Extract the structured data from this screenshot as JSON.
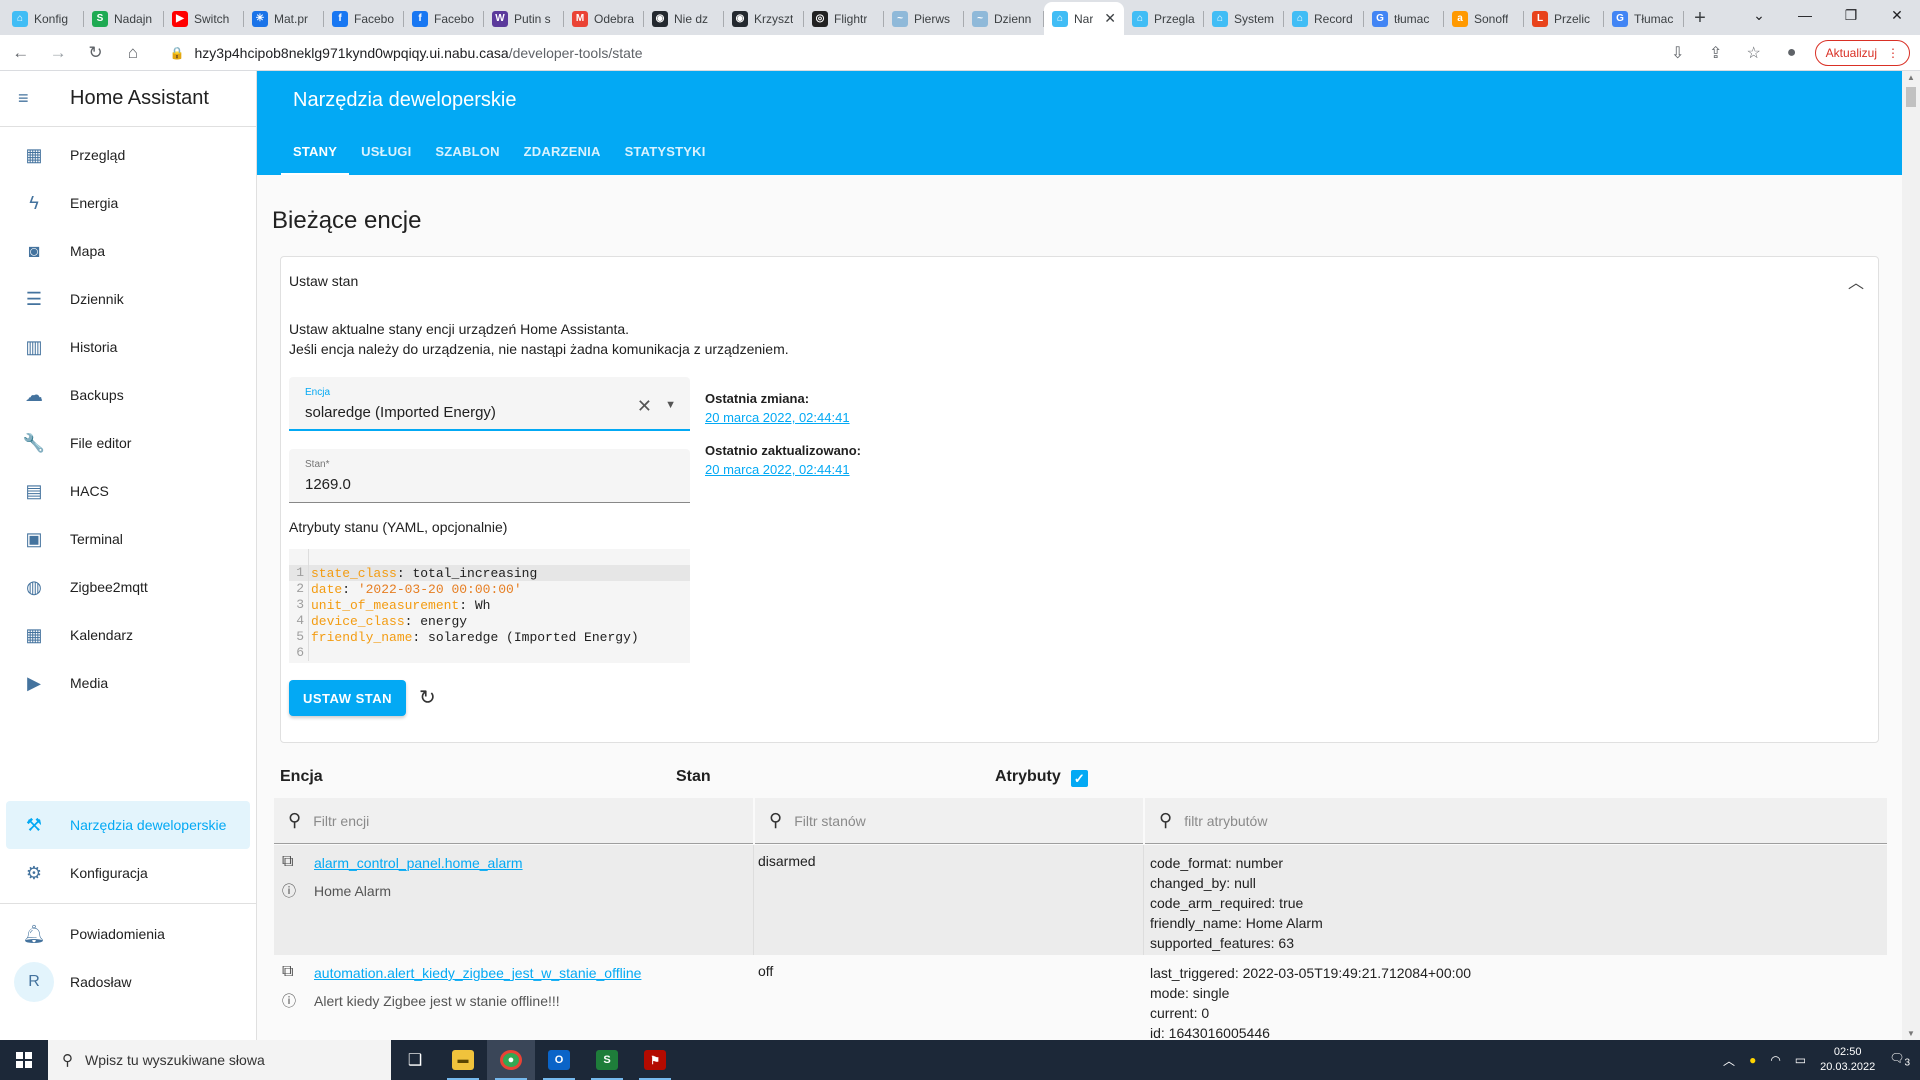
{
  "browser": {
    "tabs": [
      {
        "label": "Konfig",
        "color": "#41bdf5",
        "glyph": "⌂"
      },
      {
        "label": "Nadajn",
        "color": "#1faa53",
        "glyph": "S"
      },
      {
        "label": "Switch",
        "color": "#ff0000",
        "glyph": "▶"
      },
      {
        "label": "Mat.pr",
        "color": "#1a73e8",
        "glyph": "✳"
      },
      {
        "label": "Facebo",
        "color": "#1877f2",
        "glyph": "f"
      },
      {
        "label": "Facebo",
        "color": "#1877f2",
        "glyph": "f"
      },
      {
        "label": "Putin s",
        "color": "#5b3a9b",
        "glyph": "W"
      },
      {
        "label": "Odebra",
        "color": "#ea4335",
        "glyph": "M"
      },
      {
        "label": "Nie dz",
        "color": "#24292f",
        "glyph": "◉"
      },
      {
        "label": "Krzyszt",
        "color": "#24292f",
        "glyph": "◉"
      },
      {
        "label": "Flightr",
        "color": "#222222",
        "glyph": "◎"
      },
      {
        "label": "Pierws",
        "color": "#8fb9d9",
        "glyph": "~"
      },
      {
        "label": "Dzienn",
        "color": "#8fb9d9",
        "glyph": "~"
      },
      {
        "label": "Nar",
        "color": "#41bdf5",
        "glyph": "⌂"
      },
      {
        "label": "Przegla",
        "color": "#41bdf5",
        "glyph": "⌂"
      },
      {
        "label": "System",
        "color": "#41bdf5",
        "glyph": "⌂"
      },
      {
        "label": "Record",
        "color": "#41bdf5",
        "glyph": "⌂"
      },
      {
        "label": "tłumac",
        "color": "#4285f4",
        "glyph": "G"
      },
      {
        "label": "Sonoff",
        "color": "#ff9900",
        "glyph": "a"
      },
      {
        "label": "Przelic",
        "color": "#e8431c",
        "glyph": "L"
      },
      {
        "label": "Tłumac",
        "color": "#4285f4",
        "glyph": "G"
      }
    ],
    "active_tab_index": 13,
    "url_host": "hzy3p4hcipob8neklg971kynd0wpqiqy.ui.nabu.casa",
    "url_path": "/developer-tools/state",
    "update_label": "Aktualizuj"
  },
  "sidebar": {
    "title": "Home Assistant",
    "items": [
      {
        "label": "Przegląd",
        "icon": "dashboard-icon",
        "glyph": "▦"
      },
      {
        "label": "Energia",
        "icon": "lightning-icon",
        "glyph": "ϟ"
      },
      {
        "label": "Mapa",
        "icon": "map-person-icon",
        "glyph": "◙"
      },
      {
        "label": "Dziennik",
        "icon": "list-icon",
        "glyph": "☰"
      },
      {
        "label": "Historia",
        "icon": "chart-icon",
        "glyph": "▥"
      },
      {
        "label": "Backups",
        "icon": "cloud-icon",
        "glyph": "☁"
      },
      {
        "label": "File editor",
        "icon": "wrench-icon",
        "glyph": "🔧"
      },
      {
        "label": "HACS",
        "icon": "hacs-icon",
        "glyph": "▤"
      },
      {
        "label": "Terminal",
        "icon": "terminal-icon",
        "glyph": "▣"
      },
      {
        "label": "Zigbee2mqtt",
        "icon": "compass-icon",
        "glyph": "◍"
      },
      {
        "label": "Kalendarz",
        "icon": "calendar-icon",
        "glyph": "▦"
      },
      {
        "label": "Media",
        "icon": "media-icon",
        "glyph": "▶"
      }
    ],
    "dev_tools": "Narzędzia deweloperskie",
    "config": "Konfiguracja",
    "notifications": "Powiadomienia",
    "user": "Radosław",
    "user_initial": "R"
  },
  "header": {
    "title": "Narzędzia deweloperskie",
    "tabs": [
      "STANY",
      "USŁUGI",
      "SZABLON",
      "ZDARZENIA",
      "STATYSTYKI"
    ]
  },
  "main": {
    "heading": "Bieżące encje",
    "card_title": "Ustaw stan",
    "desc_line1": "Ustaw aktualne stany encji urządzeń Home Assistanta.",
    "desc_line2": "Jeśli encja należy do urządzenia, nie nastąpi żadna komunikacja z urządzeniem.",
    "entity_label": "Encja",
    "entity_value": "solaredge (Imported Energy)",
    "state_label": "Stan*",
    "state_value": "1269.0",
    "last_changed_label": "Ostatnia zmiana:",
    "last_changed": "20 marca 2022, 02:44:41",
    "last_updated_label": "Ostatnio zaktualizowano:",
    "last_updated": "20 marca 2022, 02:44:41",
    "attr_label": "Atrybuty stanu (YAML, opcjonalnie)",
    "yaml": [
      {
        "n": "1",
        "k": "state_class",
        "v": "total_increasing",
        "str": false
      },
      {
        "n": "2",
        "k": "date",
        "v": "'2022-03-20 00:00:00'",
        "str": true
      },
      {
        "n": "3",
        "k": "unit_of_measurement",
        "v": "Wh",
        "str": false
      },
      {
        "n": "4",
        "k": "device_class",
        "v": "energy",
        "str": false
      },
      {
        "n": "5",
        "k": "friendly_name",
        "v": "solaredge (Imported Energy)",
        "str": false
      },
      {
        "n": "6",
        "k": "",
        "v": "",
        "str": false
      }
    ],
    "set_button": "USTAW STAN"
  },
  "table": {
    "col_entity": "Encja",
    "col_state": "Stan",
    "col_attrs": "Atrybuty",
    "filter_entity": "Filtr encji",
    "filter_state": "Filtr stanów",
    "filter_attrs": "filtr atrybutów",
    "rows": [
      {
        "entity_id": "alarm_control_panel.home_alarm",
        "friendly": "Home Alarm",
        "state": "disarmed",
        "attrs": [
          "code_format: number",
          "changed_by: null",
          "code_arm_required: true",
          "friendly_name: Home Alarm",
          "supported_features: 63"
        ]
      },
      {
        "entity_id": "automation.alert_kiedy_zigbee_jest_w_stanie_offline",
        "friendly": "Alert kiedy Zigbee jest w stanie offline!!!",
        "state": "off",
        "attrs": [
          "last_triggered: 2022-03-05T19:49:21.712084+00:00",
          "mode: single",
          "current: 0",
          "id: 1643016005446"
        ]
      }
    ]
  },
  "taskbar": {
    "search_placeholder": "Wpisz tu wyszukiwane słowa",
    "time": "02:50",
    "date": "20.03.2022",
    "notif_count": "3"
  }
}
